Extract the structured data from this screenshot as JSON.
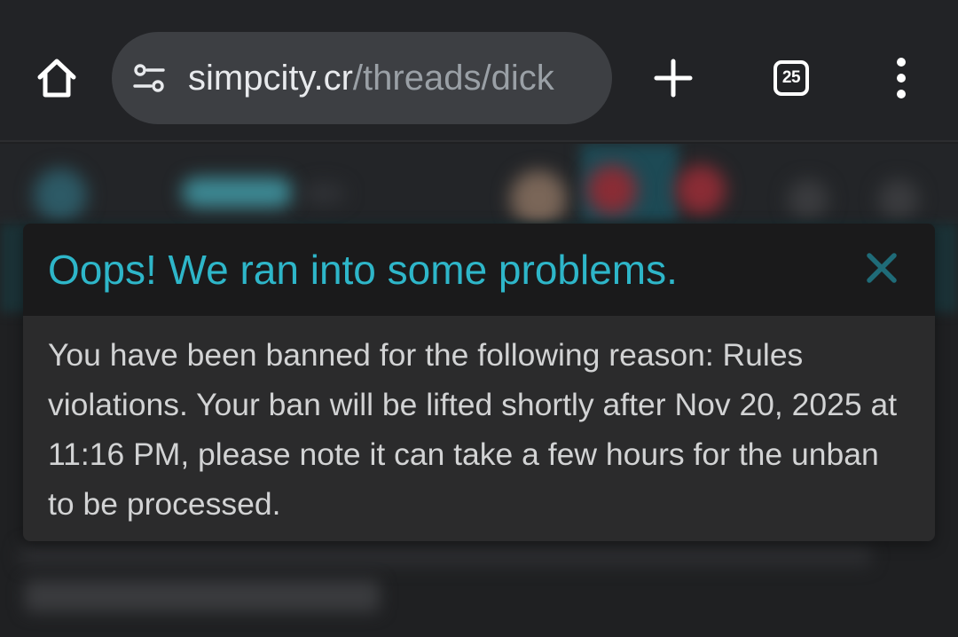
{
  "browser": {
    "url_host": "simpcity.cr",
    "url_path": "/threads/dick",
    "tab_count": "25",
    "icons": {
      "home": "home-icon",
      "site_settings": "tune-icon",
      "new_tab": "plus-icon",
      "tab_switcher": "tab-count-icon",
      "menu": "more-vert-icon"
    }
  },
  "modal": {
    "title": "Oops! We ran into some problems.",
    "message": "You have been banned for the following reason: Rules violations. Your ban will be lifted shortly after Nov 20, 2025 at 11:16 PM, please note it can take a few hours for the unban to be processed.",
    "close_icon": "close-icon"
  },
  "colors": {
    "toolbar_bg": "#222326",
    "omnibox_bg": "#3d3f43",
    "modal_title": "#2eb6c9",
    "modal_header_bg": "#1a1a1b",
    "modal_body_bg": "#2b2b2c",
    "close_icon": "#1f6b78"
  }
}
